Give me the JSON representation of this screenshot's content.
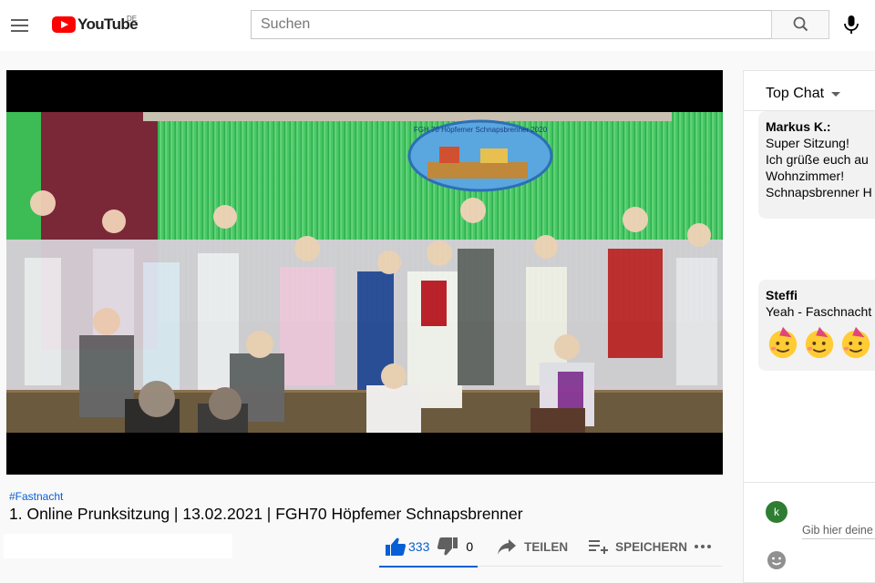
{
  "header": {
    "logo_text": "YouTube",
    "region_code": "DE",
    "search_placeholder": "Suchen"
  },
  "video": {
    "hashtag": "#Fastnacht",
    "title": "1. Online Prunksitzung | 13.02.2021 | FGH70 Höpfemer Schnapsbrenner",
    "like_count": "333",
    "dislike_count": "0",
    "like_ratio": 1.0,
    "share_label": "TEILEN",
    "save_label": "SPEICHERN",
    "banner_text": "FGH 70 Höpfemer Schnapsbrenner 2020"
  },
  "chat": {
    "mode_label": "Top Chat",
    "messages": [
      {
        "author": "Markus K.:",
        "lines": [
          "Super Sitzung!",
          "Ich grüße euch au",
          "Wohnzimmer!",
          "Schnapsbrenner H"
        ]
      },
      {
        "author": "Steffi",
        "lines": [
          "Yeah - Faschnacht"
        ],
        "emojis": [
          "partying-face",
          "partying-face",
          "partying-face"
        ]
      }
    ],
    "user_initial": "k",
    "input_placeholder": "Gib hier deine"
  },
  "colors": {
    "brand_red": "#ff0000",
    "link_blue": "#065fd4",
    "avatar_green": "#2e7d32"
  }
}
